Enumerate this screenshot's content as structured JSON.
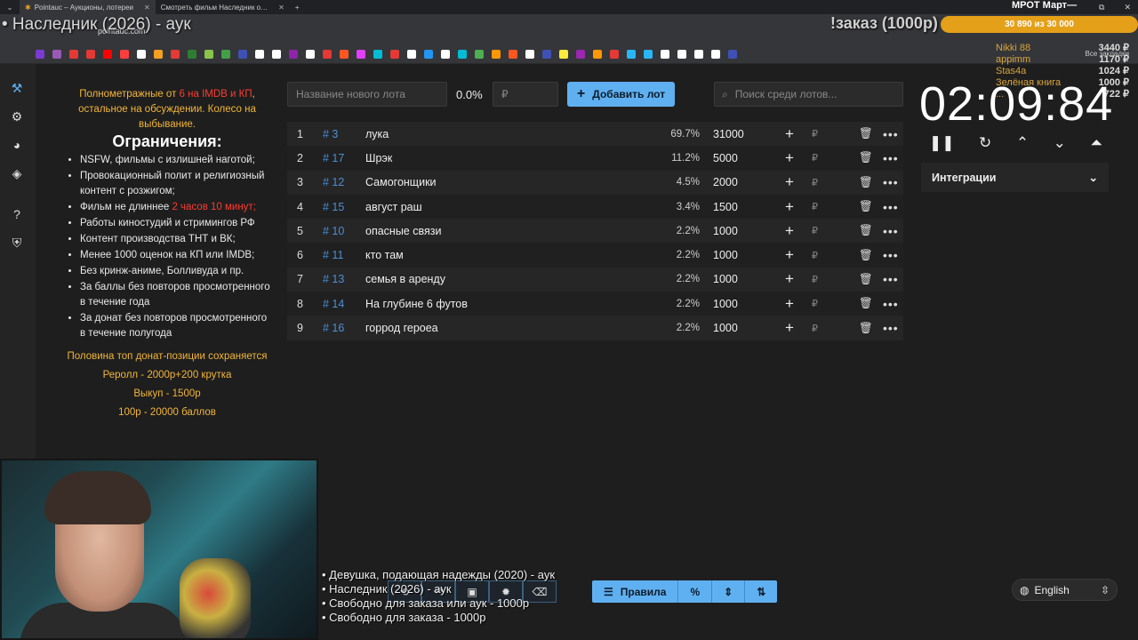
{
  "browser": {
    "tabs": [
      {
        "title": "Pointauc – Аукционы, лотереи",
        "active": true
      },
      {
        "title": "Смотреть фильм Наследник о…",
        "active": false
      }
    ],
    "url": "pointauc.com",
    "bookmarks_all_label": "Все закладки",
    "bookmark_colors": [
      "#7b3ad1",
      "#9b59b6",
      "#e53935",
      "#e53935",
      "#ff0000",
      "#ff3d3d",
      "#ffffff",
      "#f4a020",
      "#e53935",
      "#2e7d32",
      "#8bc34a",
      "#43a047",
      "#3f51b5",
      "#ffffff",
      "#ffffff",
      "#8e24aa",
      "#ffffff",
      "#e53935",
      "#ff5722",
      "#e040fb",
      "#00bcd4",
      "#e53935",
      "#ffffff",
      "#2196f3",
      "#ffffff",
      "#00bcd4",
      "#4caf50",
      "#ff9800",
      "#ff5722",
      "#ffffff",
      "#3f51b5",
      "#ffeb3b",
      "#9c27b0",
      "#ff9800",
      "#e53935",
      "#29b6f6",
      "#29b6f6",
      "#ffffff",
      "#ffffff",
      "#ffffff",
      "#ffffff",
      "#3f51b5"
    ]
  },
  "stream": {
    "title": "• Наследник (2026) - аук",
    "order_label": "!заказ (1000р)",
    "goal_title": "МРОТ Март—",
    "goal_text": "30 890  из 30 000",
    "goal_progress": 1.0,
    "donors": [
      {
        "name": "Nikki 88",
        "amount": "3440 ₽"
      },
      {
        "name": "appimm",
        "amount": "1170 ₽"
      },
      {
        "name": "Stas4a",
        "amount": "1024 ₽"
      },
      {
        "name": "Зелёная книга",
        "amount": "1000 ₽"
      },
      {
        "name": "...",
        "amount": "722 ₽"
      }
    ],
    "queue": [
      "• Девушка, подающая надежды (2020) - аук",
      "• Наследник (2026) - аук",
      "• Свободно для заказа или аук - 1000р",
      "• Свободно для заказа - 1000р"
    ]
  },
  "rules": {
    "intro_part1": "Полнометражные от ",
    "intro_red": "6 на IMDB и КП",
    "intro_part2": ", остальное на обсуждении. Колесо на выбывание.",
    "heading": "Ограничения:",
    "items": [
      "NSFW, фильмы с излишней наготой;",
      "Провокационный полит и религиозный контент с розжигом;",
      "Фильм не длиннее ",
      "Работы киностудий и стримингов РФ",
      "Контент производства ТНТ и ВК;",
      "Менее 1000 оценок на КП или IMDB;",
      "Без кринж-аниме, Болливуда и пр.",
      "За баллы без повторов просмотренного в течение года",
      "За донат без повторов просмотренного в течение полугода"
    ],
    "item3_red": "2 часов 10 минут;",
    "footer": [
      "Половина топ донат-позиции сохраняется",
      "Реролл - 2000р+200 крутка",
      "Выкуп - 1500р",
      "100р - 20000 баллов"
    ]
  },
  "toolbar": {
    "new_lot_placeholder": "Название нового лота",
    "percent": "0.0%",
    "amount_placeholder": "₽",
    "add_button": "Добавить лот",
    "search_placeholder": "Поиск среди лотов..."
  },
  "lots": [
    {
      "num": "1",
      "id": "# 3",
      "name": "лука",
      "percent": "69.7%",
      "amount": "31000"
    },
    {
      "num": "2",
      "id": "# 17",
      "name": "Шрэк",
      "percent": "11.2%",
      "amount": "5000"
    },
    {
      "num": "3",
      "id": "# 12",
      "name": "Самогонщики",
      "percent": "4.5%",
      "amount": "2000"
    },
    {
      "num": "4",
      "id": "# 15",
      "name": "август раш",
      "percent": "3.4%",
      "amount": "1500"
    },
    {
      "num": "5",
      "id": "# 10",
      "name": "опасные связи",
      "percent": "2.2%",
      "amount": "1000"
    },
    {
      "num": "6",
      "id": "# 11",
      "name": "кто там",
      "percent": "2.2%",
      "amount": "1000"
    },
    {
      "num": "7",
      "id": "# 13",
      "name": "семья в аренду",
      "percent": "2.2%",
      "amount": "1000"
    },
    {
      "num": "8",
      "id": "# 14",
      "name": "На глубине 6 футов",
      "percent": "2.2%",
      "amount": "1000"
    },
    {
      "num": "9",
      "id": "# 16",
      "name": "горрод героеа",
      "percent": "2.2%",
      "amount": "1000"
    }
  ],
  "timer": {
    "value": "02:09:84"
  },
  "integrations_label": "Интеграции",
  "bottom": {
    "rules_button": "Правила",
    "language": "English"
  }
}
